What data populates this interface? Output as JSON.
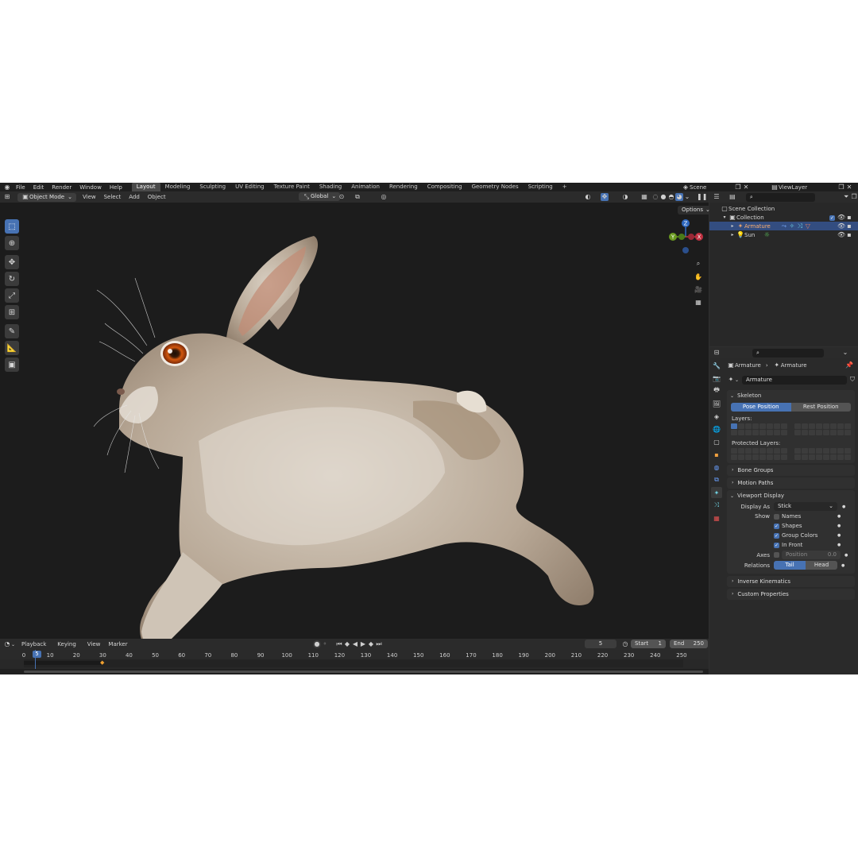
{
  "topbar": {
    "menus": [
      "File",
      "Edit",
      "Render",
      "Window",
      "Help"
    ],
    "workspaces": [
      "Layout",
      "Modeling",
      "Sculpting",
      "UV Editing",
      "Texture Paint",
      "Shading",
      "Animation",
      "Rendering",
      "Compositing",
      "Geometry Nodes",
      "Scripting"
    ],
    "active_workspace": "Layout",
    "add_tab": "+",
    "scene": "Scene",
    "view_layer": "ViewLayer"
  },
  "viewport_header": {
    "mode": "Object Mode",
    "menus": [
      "View",
      "Select",
      "Add",
      "Object"
    ],
    "transform_orientation": "Global",
    "options": "Options"
  },
  "gizmo": {
    "z": "Z",
    "y": "Y",
    "x": "X"
  },
  "outliner": {
    "root": "Scene Collection",
    "collection": "Collection",
    "items": [
      {
        "label": "Armature",
        "selected": true
      },
      {
        "label": "Sun",
        "selected": false
      }
    ]
  },
  "properties": {
    "breadcrumb": [
      "Armature",
      "Armature"
    ],
    "data_name": "Armature",
    "skeleton": {
      "title": "Skeleton",
      "pose_position": "Pose Position",
      "rest_position": "Rest Position",
      "layers_label": "Layers:",
      "protected_layers_label": "Protected Layers:"
    },
    "collapsed_panels": [
      "Bone Groups",
      "Motion Paths"
    ],
    "viewport_display": {
      "title": "Viewport Display",
      "display_as_label": "Display As",
      "display_as_value": "Stick",
      "show_label": "Show",
      "show_options": [
        {
          "label": "Names",
          "checked": false
        },
        {
          "label": "Shapes",
          "checked": true
        },
        {
          "label": "Group Colors",
          "checked": true
        },
        {
          "label": "In Front",
          "checked": true
        }
      ],
      "axes_label": "Axes",
      "axes_position_label": "Position",
      "axes_position_value": "0.0",
      "relations_label": "Relations",
      "relations_tail": "Tail",
      "relations_head": "Head"
    },
    "bottom_panels": [
      "Inverse Kinematics",
      "Custom Properties"
    ]
  },
  "timeline": {
    "menus": [
      "Playback",
      "Keying",
      "View",
      "Marker"
    ],
    "current_frame": "5",
    "start_label": "Start",
    "start_value": "1",
    "end_label": "End",
    "end_value": "250",
    "ruler": [
      "0",
      "5",
      "10",
      "20",
      "30",
      "40",
      "50",
      "60",
      "70",
      "80",
      "90",
      "100",
      "110",
      "120",
      "130",
      "140",
      "150",
      "160",
      "170",
      "180",
      "190",
      "200",
      "210",
      "220",
      "230",
      "240",
      "250"
    ]
  },
  "colors": {
    "accent": "#4772b3",
    "viewport_bg": "#1c1c1c",
    "panel_bg": "#303030",
    "header_bg": "#232323",
    "playhead": "#4772b3",
    "keyframe": "#f0a030"
  }
}
